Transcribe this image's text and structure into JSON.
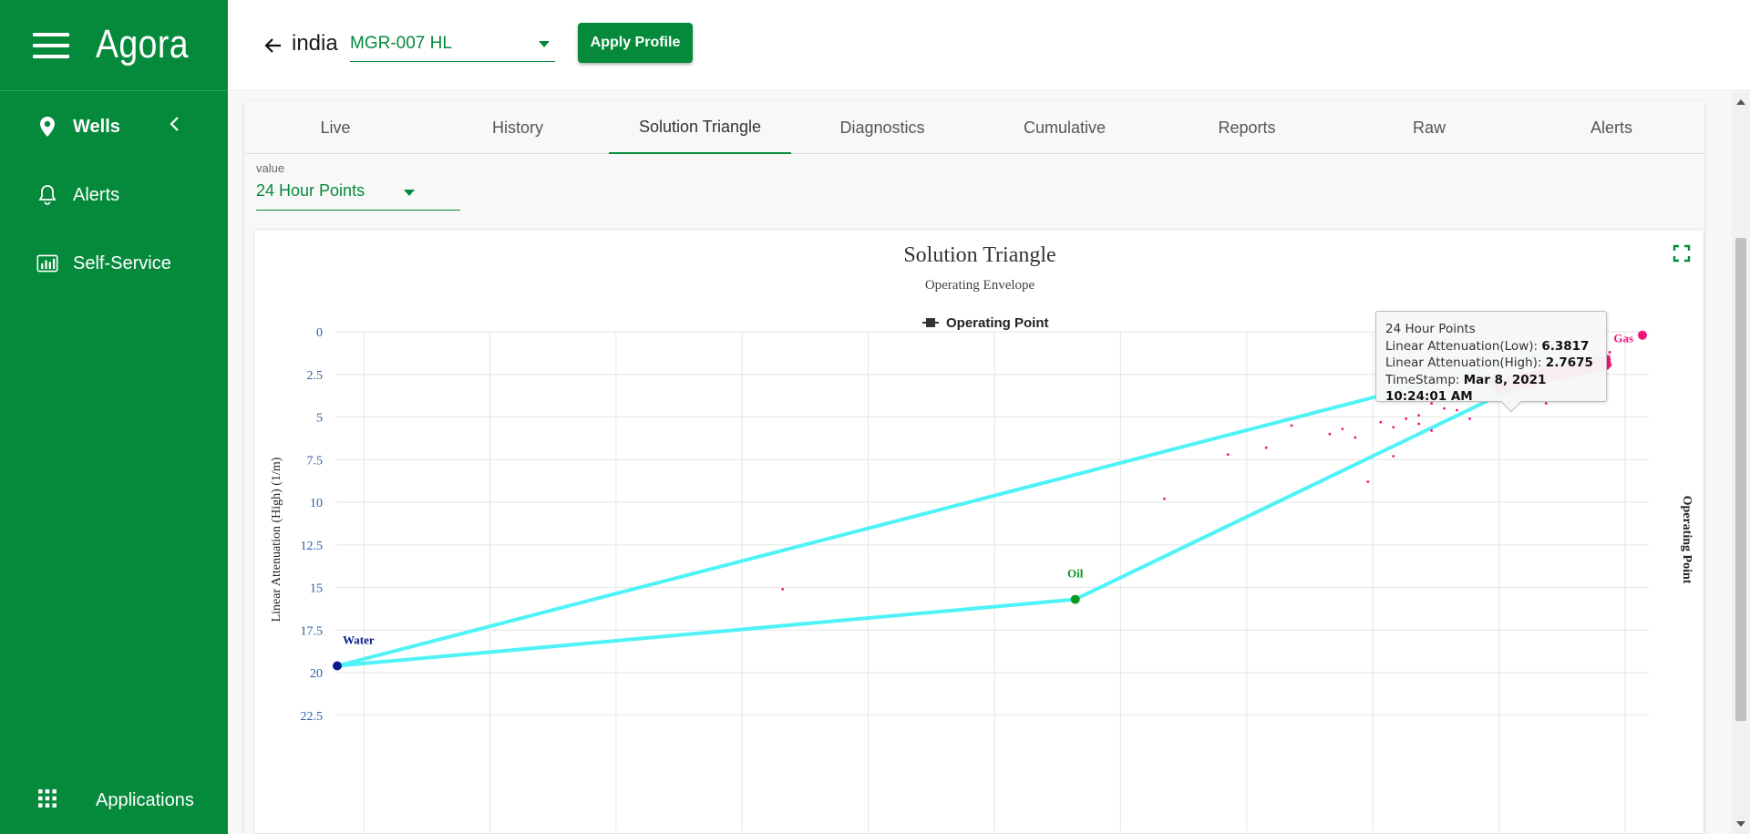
{
  "app": {
    "brand": "Agora"
  },
  "sidebar": {
    "items": [
      {
        "label": "Wells",
        "icon": "location-pin-icon",
        "active": true
      },
      {
        "label": "Alerts",
        "icon": "bell-icon",
        "active": false
      },
      {
        "label": "Self-Service",
        "icon": "bar-chart-icon",
        "active": false
      }
    ],
    "footer": {
      "label": "Applications",
      "icon": "grid-icon"
    }
  },
  "topbar": {
    "well_name": "india",
    "profile_value": "MGR-007 HL",
    "apply_label": "Apply Profile"
  },
  "tabs": [
    {
      "label": "Live"
    },
    {
      "label": "History"
    },
    {
      "label": "Solution Triangle",
      "active": true
    },
    {
      "label": "Diagnostics"
    },
    {
      "label": "Cumulative"
    },
    {
      "label": "Reports"
    },
    {
      "label": "Raw"
    },
    {
      "label": "Alerts"
    }
  ],
  "value_select": {
    "caption": "value",
    "value": "24 Hour Points"
  },
  "tooltip": {
    "series": "24 Hour Points",
    "low_label": "Linear Attenuation(Low): ",
    "low_value": "6.3817",
    "high_label": "Linear Attenuation(High): ",
    "high_value": "2.7675",
    "ts_label": "TimeStamp: ",
    "ts_value": "Mar 8, 2021 10:24:01 AM"
  },
  "colors": {
    "brand_green": "#058a3c",
    "triangle_line": "#4ff3f7",
    "points": "#f0157a",
    "water": "#0a1a8c",
    "oil": "#0b9a1e",
    "gas": "#f0157a",
    "tick": "#2a5da8"
  },
  "chart_data": {
    "type": "scatter",
    "title": "Solution Triangle",
    "subtitle": "Operating Envelope",
    "legend": [
      "Operating Point"
    ],
    "legend_position": "top-center",
    "ylabel": "Linear Attenuation (High) (1/m)",
    "right_label": "Operating Point",
    "y_ticks": [
      "0",
      "2.5",
      "5",
      "7.5",
      "10",
      "12.5",
      "15",
      "17.5",
      "20",
      "22.5"
    ],
    "y_reversed": true,
    "ylim": [
      0,
      22.5
    ],
    "xlim": [
      0,
      10
    ],
    "grid": true,
    "triangle": {
      "water": {
        "label": "Water",
        "x": 0,
        "y": 19.6
      },
      "oil": {
        "label": "Oil",
        "x": 5.8,
        "y": 15.7
      },
      "gas": {
        "label": "Gas",
        "x": 10.2,
        "y": 0.2
      }
    },
    "selected_point": {
      "x": 9.1,
      "y": 2.9
    },
    "points": [
      [
        3.5,
        15.1
      ],
      [
        6.5,
        9.8
      ],
      [
        7.0,
        7.2
      ],
      [
        7.3,
        6.8
      ],
      [
        7.5,
        5.5
      ],
      [
        7.8,
        6.0
      ],
      [
        7.9,
        5.7
      ],
      [
        8.0,
        6.2
      ],
      [
        8.2,
        5.3
      ],
      [
        8.3,
        5.6
      ],
      [
        8.3,
        7.3
      ],
      [
        8.4,
        5.1
      ],
      [
        8.5,
        5.4
      ],
      [
        8.5,
        4.9
      ],
      [
        8.6,
        4.2
      ],
      [
        8.1,
        8.8
      ],
      [
        8.7,
        4.5
      ],
      [
        8.8,
        3.8
      ],
      [
        8.8,
        4.6
      ],
      [
        8.9,
        3.4
      ],
      [
        9.0,
        3.6
      ],
      [
        9.0,
        4.0
      ],
      [
        9.1,
        3.2
      ],
      [
        9.2,
        3.3
      ],
      [
        9.3,
        3.5
      ],
      [
        9.3,
        2.6
      ],
      [
        9.4,
        2.9
      ],
      [
        9.5,
        2.4
      ],
      [
        9.5,
        3.1
      ],
      [
        9.6,
        2.1
      ],
      [
        9.7,
        2.3
      ],
      [
        9.8,
        1.8
      ],
      [
        9.8,
        2.8
      ],
      [
        9.9,
        1.5
      ],
      [
        10.0,
        1.2
      ],
      [
        9.4,
        3.8
      ],
      [
        9.6,
        3.4
      ],
      [
        9.2,
        4.1
      ],
      [
        8.9,
        5.1
      ],
      [
        8.6,
        5.8
      ],
      [
        9.7,
        3.6
      ],
      [
        9.9,
        3.1
      ],
      [
        9.5,
        4.2
      ],
      [
        9.0,
        2.8
      ],
      [
        9.15,
        3.0
      ],
      [
        9.25,
        2.7
      ],
      [
        9.35,
        3.1
      ],
      [
        9.45,
        2.6
      ],
      [
        9.55,
        2.5
      ],
      [
        9.65,
        2.2
      ],
      [
        9.05,
        3.3
      ],
      [
        9.2,
        2.9
      ],
      [
        9.3,
        3.3
      ],
      [
        9.4,
        2.5
      ],
      [
        9.6,
        2.6
      ],
      [
        9.7,
        2.0
      ],
      [
        9.8,
        2.2
      ],
      [
        9.75,
        1.9
      ],
      [
        9.85,
        2.0
      ],
      [
        9.1,
        3.5
      ],
      [
        9.0,
        3.1
      ],
      [
        8.95,
        3.4
      ],
      [
        9.2,
        3.6
      ],
      [
        9.35,
        2.8
      ],
      [
        9.5,
        2.8
      ],
      [
        9.55,
        2.3
      ],
      [
        9.45,
        2.9
      ],
      [
        9.62,
        2.4
      ],
      [
        9.72,
        2.1
      ],
      [
        9.82,
        1.9
      ]
    ]
  }
}
